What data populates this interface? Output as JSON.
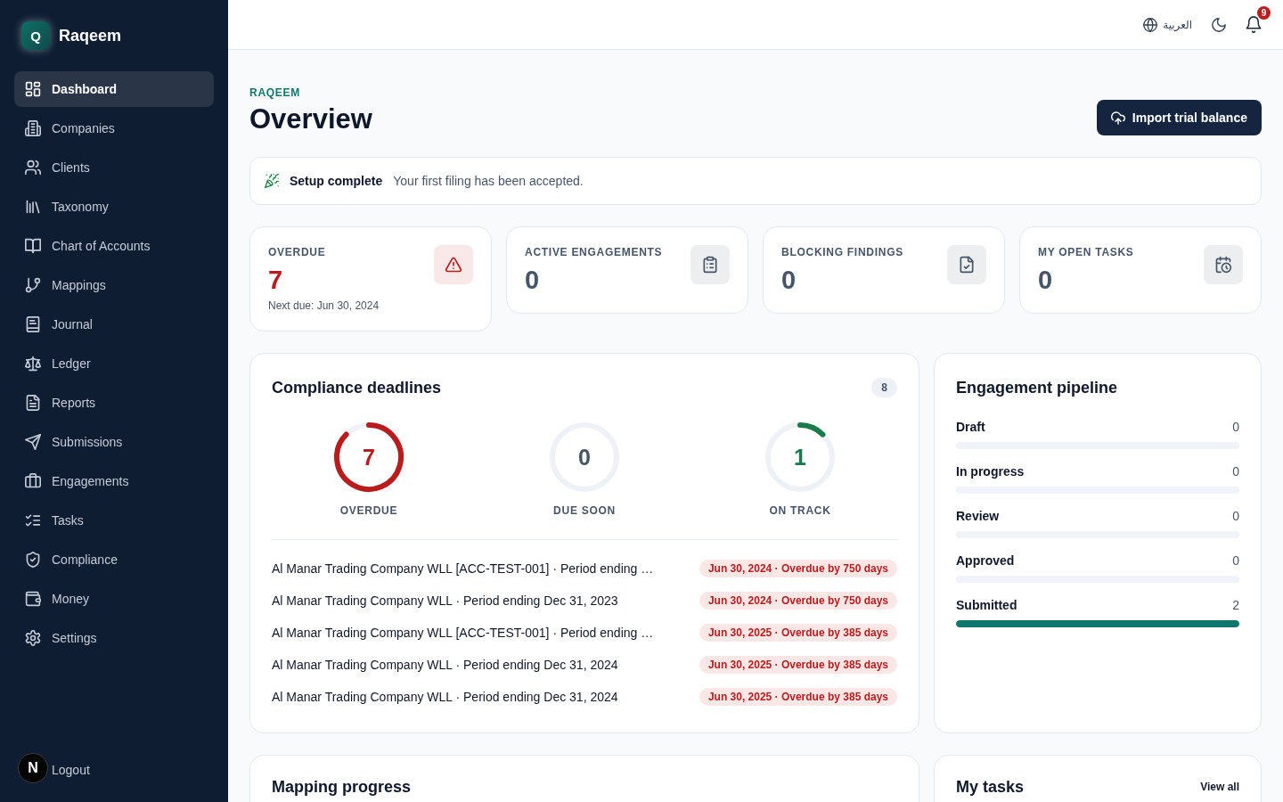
{
  "sidebar": {
    "logo": {
      "letter": "Q",
      "name": "Raqeem"
    },
    "items": [
      {
        "label": "Dashboard",
        "selected": true
      },
      {
        "label": "Companies",
        "selected": false
      },
      {
        "label": "Clients",
        "selected": false
      },
      {
        "label": "Taxonomy",
        "selected": false
      },
      {
        "label": "Chart of Accounts",
        "selected": false
      },
      {
        "label": "Mappings",
        "selected": false
      },
      {
        "label": "Journal",
        "selected": false
      },
      {
        "label": "Ledger",
        "selected": false
      },
      {
        "label": "Reports",
        "selected": false
      },
      {
        "label": "Submissions",
        "selected": false
      },
      {
        "label": "Engagements",
        "selected": false
      },
      {
        "label": "Tasks",
        "selected": false
      },
      {
        "label": "Compliance",
        "selected": false
      },
      {
        "label": "Money",
        "selected": false
      },
      {
        "label": "Settings",
        "selected": false
      }
    ],
    "logout": {
      "label": "Logout"
    },
    "avatar": {
      "letter": "N"
    }
  },
  "header": {
    "language": "العربية",
    "notifications": "9"
  },
  "page": {
    "eyebrow": "RAQEEM",
    "title": "Overview",
    "action": "Import trial balance"
  },
  "banner": {
    "title": "Setup complete",
    "message": "Your first filing has been accepted."
  },
  "stats": [
    {
      "label": "OVERDUE",
      "value": "7",
      "note": "Next due: Jun 30, 2024",
      "color": "#b91c1c"
    },
    {
      "label": "ACTIVE ENGAGEMENTS",
      "value": "0",
      "color": "#475569"
    },
    {
      "label": "BLOCKING FINDINGS",
      "value": "0",
      "color": "#475569"
    },
    {
      "label": "MY OPEN TASKS",
      "value": "0",
      "color": "#475569"
    }
  ],
  "compliance": {
    "title": "Compliance deadlines",
    "count": "8",
    "rings": [
      {
        "value": "7",
        "label": "OVERDUE",
        "color": "#b91c1c"
      },
      {
        "value": "0",
        "label": "DUE SOON",
        "color": "#475569"
      },
      {
        "value": "1",
        "label": "ON TRACK",
        "color": "#1b7a4b"
      }
    ],
    "deadlines": [
      {
        "name": "Al Manar Trading Company WLL [ACC-TEST-001] · Period ending …",
        "status": "Jun 30, 2024 · Overdue by 750 days"
      },
      {
        "name": "Al Manar Trading Company WLL · Period ending Dec 31, 2023",
        "status": "Jun 30, 2024 · Overdue by 750 days"
      },
      {
        "name": "Al Manar Trading Company WLL [ACC-TEST-001] · Period ending …",
        "status": "Jun 30, 2025 · Overdue by 385 days"
      },
      {
        "name": "Al Manar Trading Company WLL · Period ending Dec 31, 2024",
        "status": "Jun 30, 2025 · Overdue by 385 days"
      },
      {
        "name": "Al Manar Trading Company WLL · Period ending Dec 31, 2024",
        "status": "Jun 30, 2025 · Overdue by 385 days"
      }
    ]
  },
  "pipeline": {
    "title": "Engagement pipeline",
    "stages": [
      {
        "label": "Draft",
        "count": "0"
      },
      {
        "label": "In progress",
        "count": "0"
      },
      {
        "label": "Review",
        "count": "0"
      },
      {
        "label": "Approved",
        "count": "0"
      },
      {
        "label": "Submitted",
        "count": "2"
      }
    ]
  },
  "mapping": {
    "title": "Mapping progress"
  },
  "tasks": {
    "title": "My tasks",
    "link": "View all"
  }
}
